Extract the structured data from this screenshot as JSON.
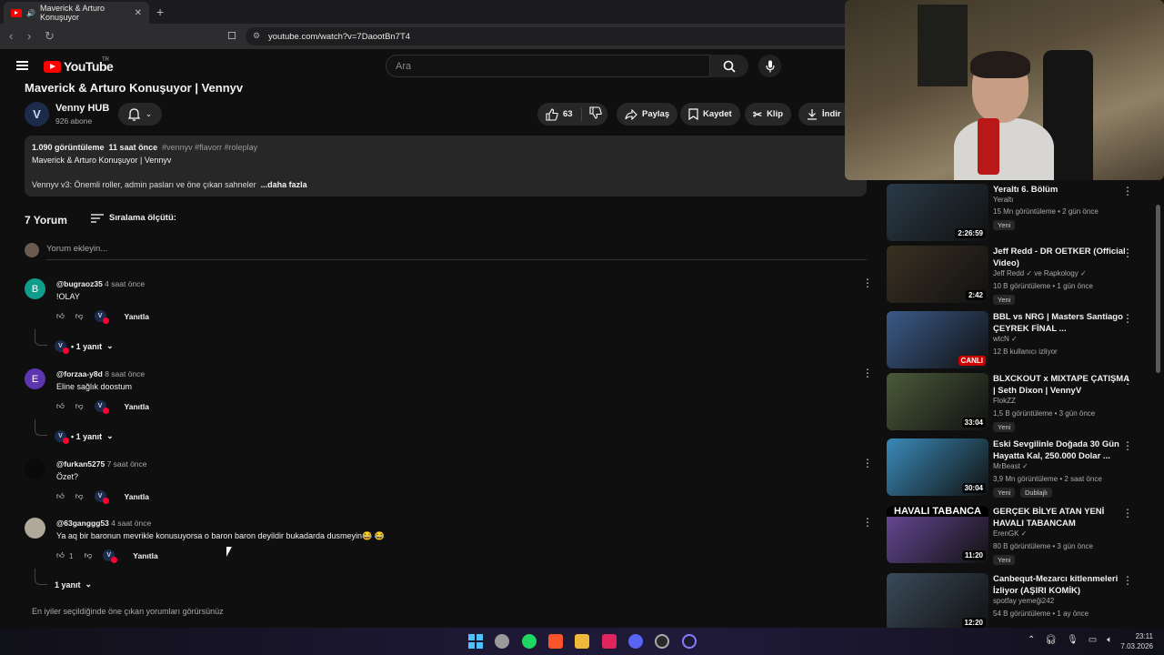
{
  "browser": {
    "tab_title": "Maverick & Arturo Konuşuyor",
    "url": "youtube.com/watch?v=7DaootBn7T4"
  },
  "header": {
    "logo_text": "YouTube",
    "logo_region": "TR",
    "search_placeholder": "Ara"
  },
  "video": {
    "title": "Maverick & Arturo Konuşuyor | Vennyv",
    "channel_name": "Venny HUB",
    "channel_subs": "926 abone",
    "channel_initial": "V",
    "likes": "63",
    "share_label": "Paylaş",
    "save_label": "Kaydet",
    "clip_label": "Klip",
    "download_label": "İndir",
    "desc_views": "1.090 görüntüleme",
    "desc_time": "11 saat önce",
    "desc_tags": "#vennyv #flavorr #roleplay",
    "desc_line1": "Maverick & Arturo Konuşuyor | Vennyv",
    "desc_line2": "Vennyv v3: Önemli roller, admin pasları ve öne çıkan sahneler",
    "desc_more": "...daha fazla"
  },
  "comments": {
    "count_label": "7 Yorum",
    "sort_label": "Sıralama ölçütü:",
    "add_placeholder": "Yorum ekleyin...",
    "reply_label": "Yanıtla",
    "items": [
      {
        "initial": "B",
        "color": "#0f9d8c",
        "user": "@bugraoz35",
        "time": "4 saat önce",
        "text": "!OLAY",
        "replies": "• 1 yanıt"
      },
      {
        "initial": "E",
        "color": "#5e35b1",
        "user": "@forzaa-y8d",
        "time": "8 saat önce",
        "text": "Eline sağlık doostum",
        "replies": "• 1 yanıt"
      },
      {
        "initial": "",
        "color": "#0a0a0a",
        "user": "@furkan5275",
        "time": "7 saat önce",
        "text": "Özet?",
        "replies": ""
      },
      {
        "initial": "",
        "color": "#b0a898",
        "user": "@63ganggg53",
        "time": "4 saat önce",
        "text": "Ya aq bir baronun mevrikle konusuyorsa o baron baron deyildir bukadarda dusmeyin😂 😂",
        "likes": "1",
        "replies": "1 yanıt"
      }
    ],
    "footer_note": "En iyiler seçildiğinde öne çıkan yorumları görürsünüz"
  },
  "sidebar": {
    "items": [
      {
        "title": "Yeraltı 6. Bölüm",
        "channel": "Yeraltı",
        "meta": "15 Mn görüntüleme • 2 gün önce",
        "badge": "Yeni",
        "duration": "2:26:59",
        "thumb": "#2a3a48"
      },
      {
        "title": "Jeff Redd - DR OETKER (Official Video)",
        "channel": "Jeff Redd ✓ ve Rapkology ✓",
        "meta": "10 B görüntüleme • 1 gün önce",
        "badge": "Yeni",
        "duration": "2:42",
        "thumb": "#3a3022"
      },
      {
        "title": "BBL vs NRG | Masters Santiago ÇEYREK FİNAL ...",
        "channel": "wtcN ✓",
        "meta": "12 B kullanıcı izliyor",
        "badge": "",
        "duration": "CANLI",
        "thumb": "#3a5a88"
      },
      {
        "title": "BLXCKOUT x MIXTAPE ÇATIŞMA | Seth Dixon | VennyV",
        "channel": "FlokZZ",
        "meta": "1,5 B görüntüleme • 3 gün önce",
        "badge": "Yeni",
        "duration": "33:04",
        "thumb": "#4a5a3a"
      },
      {
        "title": "Eski Sevgilinle Doğada 30 Gün Hayatta Kal, 250.000 Dolar ...",
        "channel": "MrBeast ✓",
        "meta": "3,9 Mn görüntüleme • 2 saat önce",
        "badge": "Yeni",
        "badge2": "Dublajlı",
        "duration": "30:04",
        "thumb": "#3a8ab8"
      },
      {
        "title": "GERÇEK BİLYE ATAN YENİ HAVALI TABANCAM",
        "channel": "ErenGK ✓",
        "meta": "80 B görüntüleme • 3 gün önce",
        "badge": "Yeni",
        "duration": "11:20",
        "thumb": "#6a4a9a",
        "thumb_text": "HAVALI TABANCA"
      },
      {
        "title": "Canbequt-Mezarcı kitlenmeleri İzliyor (AŞIRI KOMİK)",
        "channel": "spotfay yemeği242",
        "meta": "54 B görüntüleme • 1 ay önce",
        "badge": "",
        "duration": "12:20",
        "thumb": "#3a4a5a"
      }
    ]
  },
  "taskbar": {
    "time": "23:11",
    "date": "7.03.2026"
  }
}
